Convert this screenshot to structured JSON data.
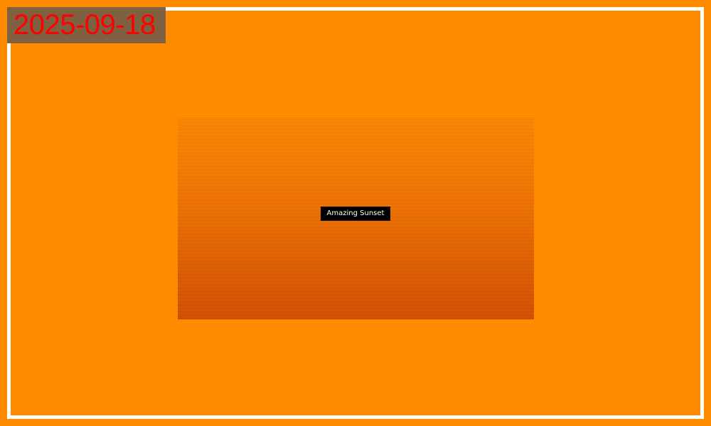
{
  "photo": {
    "date_stamp": "2025-09-18",
    "caption": "Amazing Sunset"
  },
  "colors": {
    "background": "#ff8c00",
    "frame": "#ffffff",
    "date_text": "#ff0000",
    "date_background": "#7f6040",
    "caption_background": "#000000",
    "caption_text": "#ffffff"
  }
}
